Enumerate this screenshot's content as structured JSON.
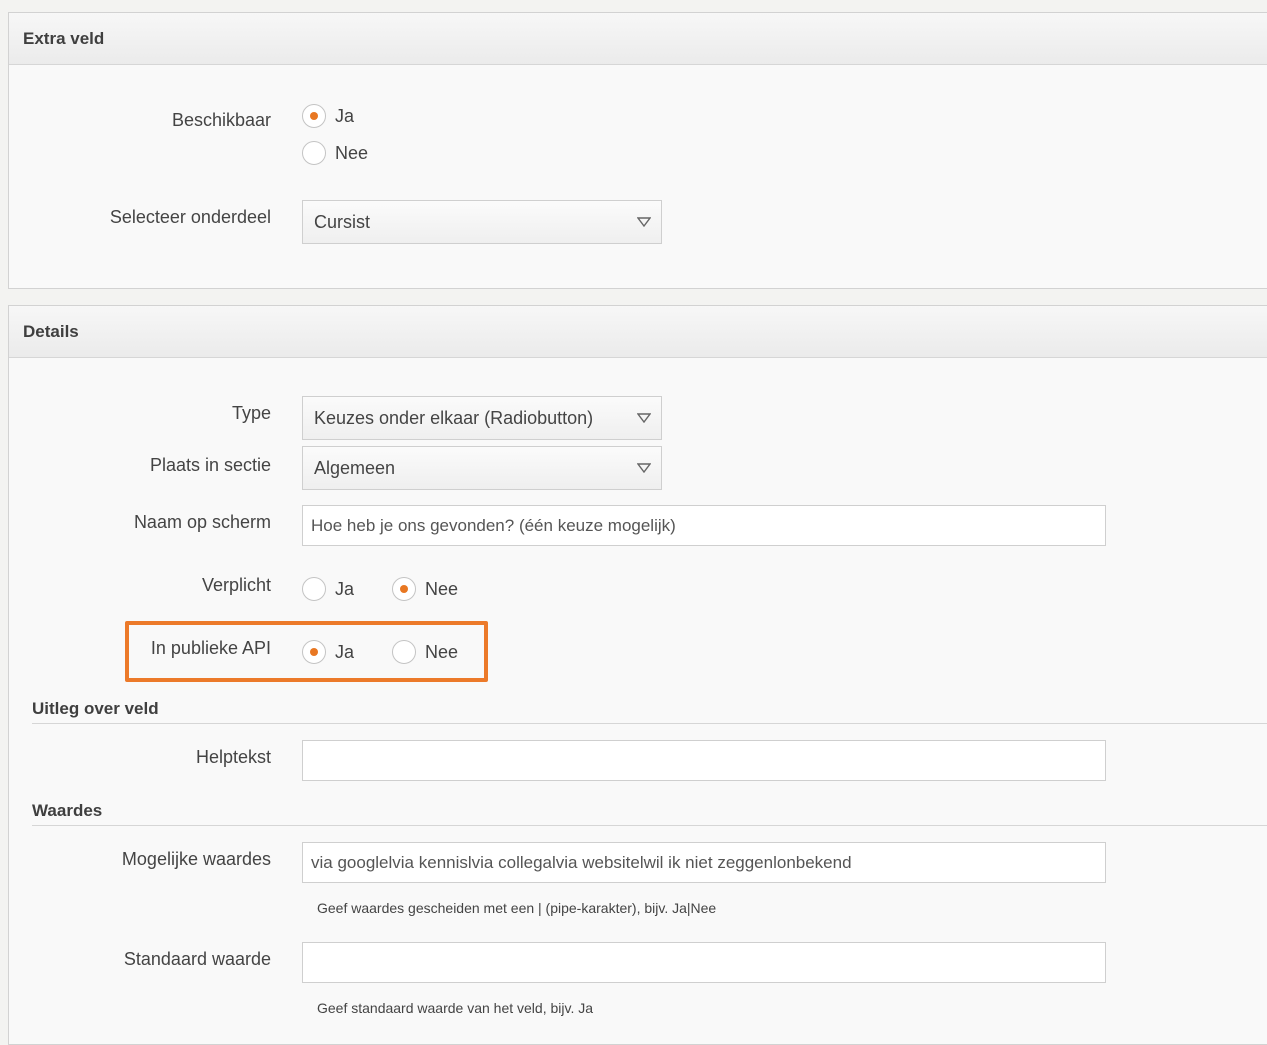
{
  "extra_veld": {
    "title": "Extra veld",
    "beschikbaar": {
      "label": "Beschikbaar",
      "options": [
        "Ja",
        "Nee"
      ],
      "selected": "Ja"
    },
    "onderdeel": {
      "label": "Selecteer onderdeel",
      "value": "Cursist"
    }
  },
  "details": {
    "title": "Details",
    "type": {
      "label": "Type",
      "value": "Keuzes onder elkaar (Radiobutton)"
    },
    "plaats": {
      "label": "Plaats in sectie",
      "value": "Algemeen"
    },
    "naam": {
      "label": "Naam op scherm",
      "value": "Hoe heb je ons gevonden? (één keuze mogelijk)"
    },
    "verplicht": {
      "label": "Verplicht",
      "options": [
        "Ja",
        "Nee"
      ],
      "selected": "Nee"
    },
    "publieke_api": {
      "label": "In publieke API",
      "options": [
        "Ja",
        "Nee"
      ],
      "selected": "Ja"
    }
  },
  "uitleg": {
    "title": "Uitleg over veld",
    "helptekst": {
      "label": "Helptekst",
      "value": ""
    }
  },
  "waardes": {
    "title": "Waardes",
    "mogelijke": {
      "label": "Mogelijke waardes",
      "value": "via googlelvia kennislvia collegalvia websitelwil ik niet zeggenlonbekend",
      "hint": "Geef waardes gescheiden met een | (pipe-karakter), bijv. Ja|Nee"
    },
    "standaard": {
      "label": "Standaard waarde",
      "value": "",
      "hint": "Geef standaard waarde van het veld, bijv. Ja"
    }
  },
  "colors": {
    "accent": "#e87722",
    "highlight_border": "#ec7a2a"
  }
}
